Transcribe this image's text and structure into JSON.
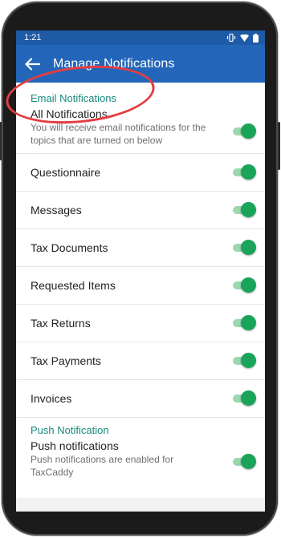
{
  "status_bar": {
    "time": "1:21"
  },
  "app_bar": {
    "title": "Manage Notifications"
  },
  "email_section": {
    "header": "Email Notifications",
    "all": {
      "title": "All Notifications",
      "subtitle": "You will receive email notifications for the topics that are turned on below",
      "on": true
    },
    "items": [
      {
        "label": "Questionnaire",
        "on": true
      },
      {
        "label": "Messages",
        "on": true
      },
      {
        "label": "Tax Documents",
        "on": true
      },
      {
        "label": "Requested Items",
        "on": true
      },
      {
        "label": "Tax Returns",
        "on": true
      },
      {
        "label": "Tax Payments",
        "on": true
      },
      {
        "label": "Invoices",
        "on": true
      }
    ]
  },
  "push_section": {
    "header": "Push Notification",
    "item": {
      "title": "Push notifications",
      "subtitle": "Push notifications are enabled for TaxCaddy",
      "on": true
    }
  },
  "colors": {
    "app_bar": "#2366b9",
    "accent_teal": "#188a7c",
    "toggle_on": "#19a45a",
    "annotation": "#e33d42"
  }
}
